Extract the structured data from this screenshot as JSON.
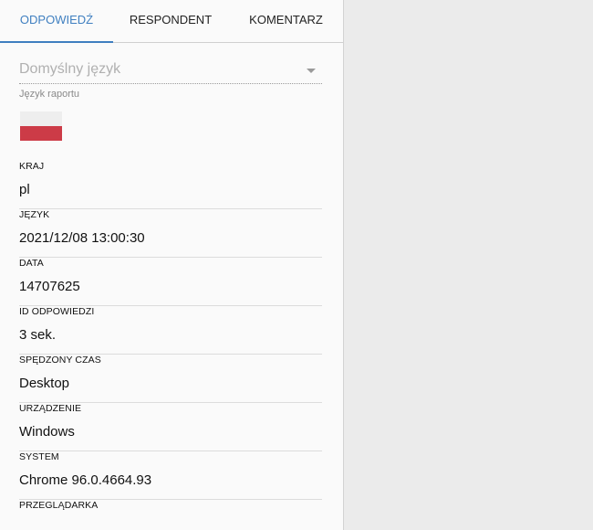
{
  "tabs": [
    {
      "label": "ODPOWIEDŹ",
      "active": true
    },
    {
      "label": "RESPONDENT",
      "active": false
    },
    {
      "label": "KOMENTARZ",
      "active": false
    }
  ],
  "language_select": {
    "value": "Domyślny język",
    "helper": "Język raportu"
  },
  "flag_icon": "poland-flag-icon",
  "fields": [
    {
      "label": "KRAJ",
      "value": "pl"
    },
    {
      "label": "JĘZYK",
      "value": "2021/12/08 13:00:30"
    },
    {
      "label": "DATA",
      "value": "14707625"
    },
    {
      "label": "ID ODPOWIEDZI",
      "value": "3 sek."
    },
    {
      "label": "SPĘDZONY CZAS",
      "value": "Desktop"
    },
    {
      "label": "URZĄDZENIE",
      "value": "Windows"
    },
    {
      "label": "SYSTEM",
      "value": "Chrome 96.0.4664.93"
    },
    {
      "label": "PRZEGLĄDARKA",
      "value": ""
    }
  ],
  "colors": {
    "accent": "#3f7fc0",
    "panel_bg": "#fafafa",
    "page_bg": "#ebebeb",
    "flag_white": "#eeeeee",
    "flag_red": "#cc3b47"
  }
}
